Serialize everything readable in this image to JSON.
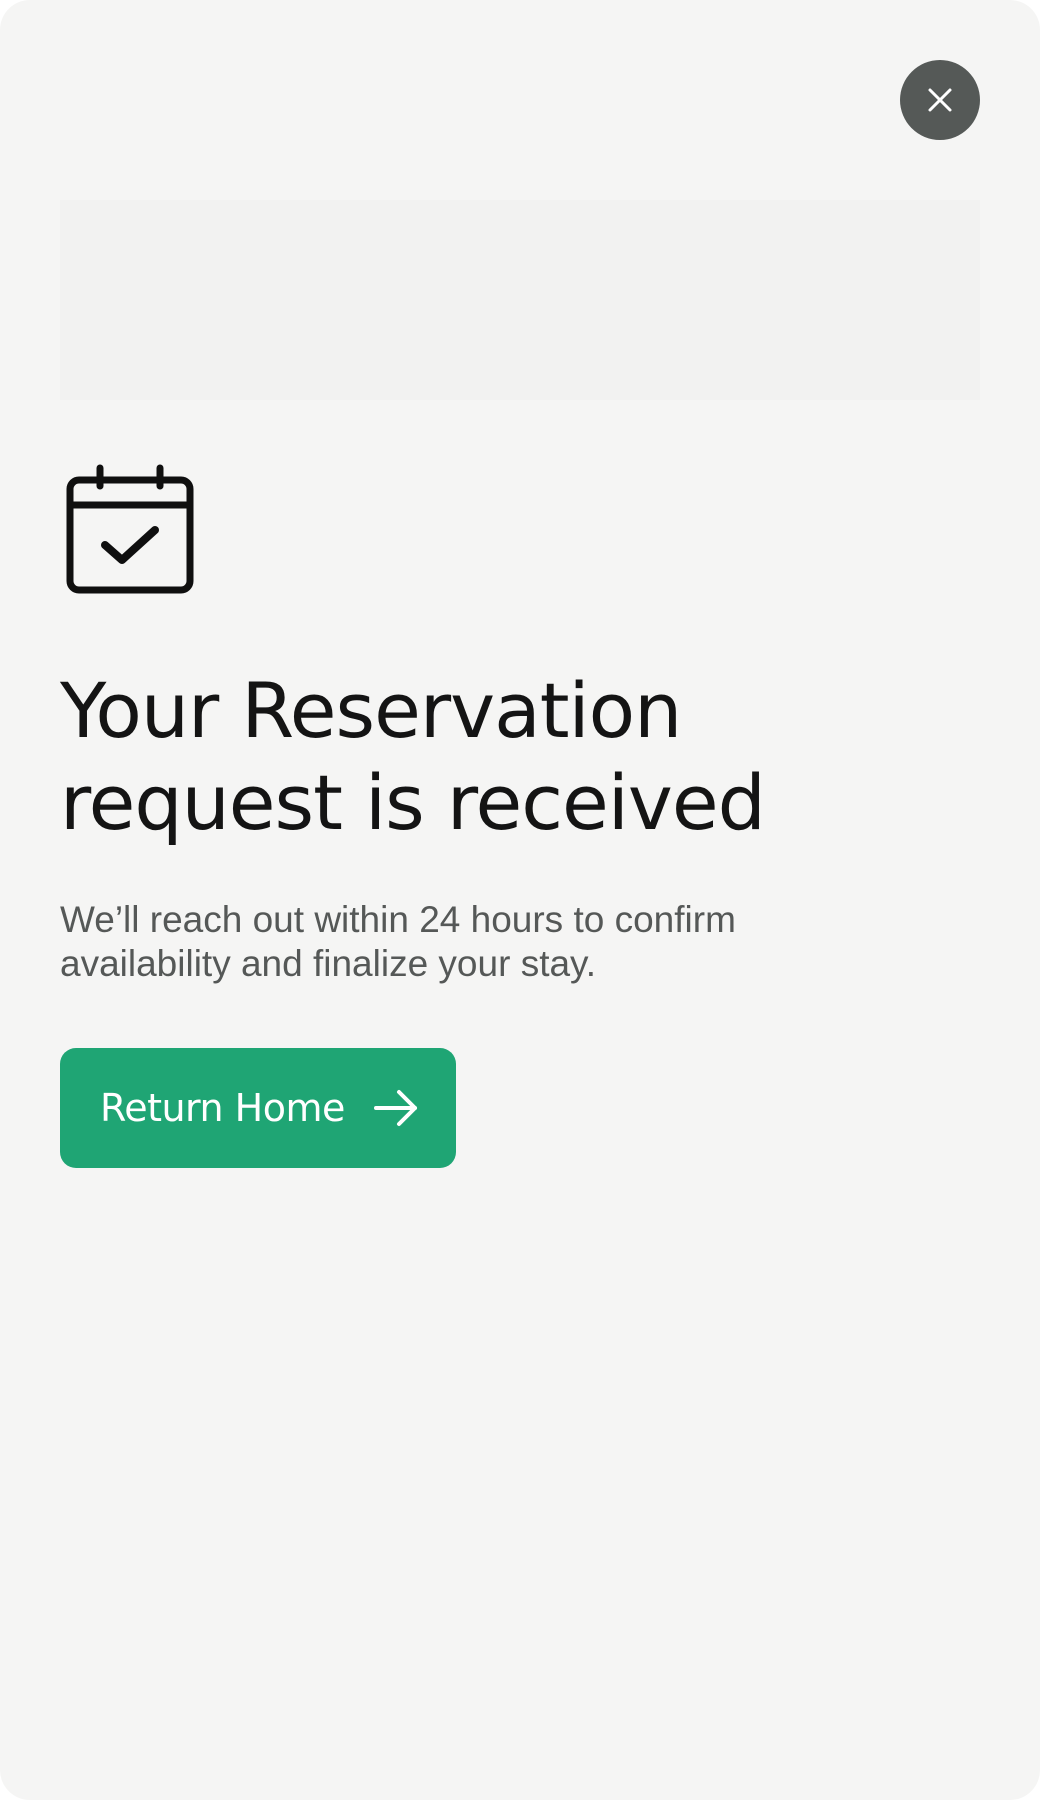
{
  "modal": {
    "close_icon": "close-icon",
    "status_icon": "calendar-check-icon",
    "title_line1": "Your Reservation",
    "title_line2": "request is received",
    "message_line1": "We’ll reach out within 24 hours to confirm",
    "message_line2": "availability and finalize your stay.",
    "primary_button": {
      "label": "Return Home",
      "icon": "arrow-right-icon"
    }
  },
  "colors": {
    "background": "#f5f5f4",
    "close_button": "#555957",
    "accent": "#1fa574",
    "title": "#141414",
    "body_text": "#555857"
  }
}
